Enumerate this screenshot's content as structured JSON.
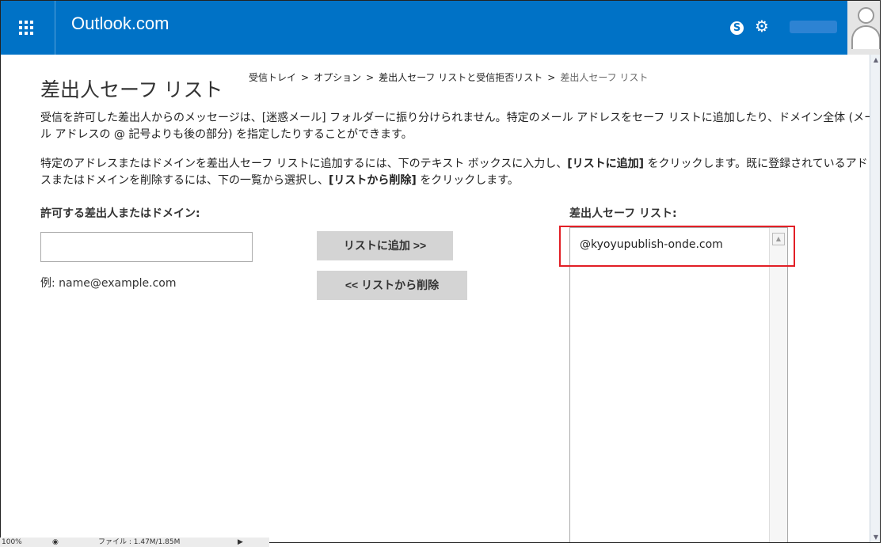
{
  "header": {
    "brand": "Outlook.com",
    "skype_glyph": "S",
    "skype_icon": "skype-icon",
    "gear_icon": "gear-icon",
    "apps_icon": "app-launcher-icon",
    "accent_color": "#0072c6"
  },
  "page": {
    "title": "差出人セーフ リスト",
    "breadcrumb": [
      "受信トレイ",
      "オプション",
      "差出人セーフ リストと受信拒否リスト",
      "差出人セーフ リスト"
    ],
    "breadcrumb_separator": ">",
    "para1": "受信を許可した差出人からのメッセージは、[迷惑メール] フォルダーに振り分けられません。特定のメール アドレスをセーフ リストに追加したり、ドメイン全体 (メール アドレスの @ 記号よりも後の部分) を指定したりすることができます。",
    "para2_a": "特定のアドレスまたはドメインを差出人セーフ リストに追加するには、下のテキスト ボックスに入力し、",
    "para2_b": "[リストに追加]",
    "para2_c": " をクリックします。既に登録されているアドレスまたはドメインを削除するには、下の一覧から選択し、",
    "para2_d": "[リストから削除]",
    "para2_e": " をクリックします。"
  },
  "form": {
    "input_label": "許可する差出人またはドメイン:",
    "input_value": "",
    "example": "例: name@example.com",
    "add_button": "リストに追加 >>",
    "remove_button": "<< リストから削除"
  },
  "safe_list": {
    "label": "差出人セーフ リスト:",
    "items": [
      "@kyoyupublish-onde.com"
    ],
    "highlight_color": "#e21f26"
  },
  "status": {
    "zoom": "100%",
    "file": "ファイル : 1.47M/1.85M"
  }
}
